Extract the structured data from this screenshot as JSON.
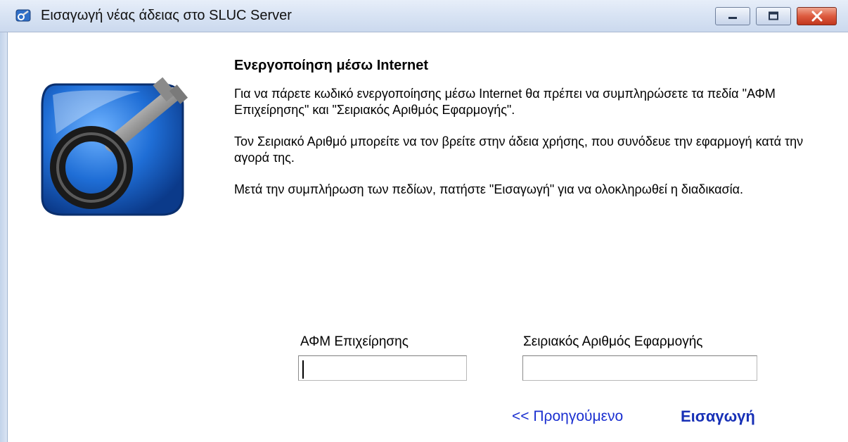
{
  "window": {
    "title": "Εισαγωγή νέας άδειας στο SLUC Server",
    "buttons": [
      "minimize-icon",
      "maximize-icon",
      "close-icon"
    ],
    "close_color": "#d84a2c"
  },
  "content": {
    "heading": "Ενεργοποίηση μέσω Internet",
    "paragraphs": [
      "Για να πάρετε κωδικό ενεργοποίησης μέσω Internet θα πρέπει να συμπληρώσετε τα πεδία \"ΑΦΜ Επιχείρησης\" και \"Σειριακός Αριθμός Εφαρμογής\".",
      "Τον Σειριακό Αριθμό μπορείτε να τον βρείτε στην άδεια χρήσης, που συνόδευε την εφαρμογή κατά την αγορά της.",
      "Μετά την συμπλήρωση των πεδίων, πατήστε \"Εισαγωγή\" για να ολοκληρωθεί η διαδικασία."
    ]
  },
  "form": {
    "afm": {
      "label": "ΑΦΜ Επιχείρησης",
      "value": ""
    },
    "serial": {
      "label": "Σειριακός Αριθμός Εφαρμογής",
      "value": ""
    }
  },
  "nav": {
    "back_label": "<< Προηγούμενο",
    "submit_label": "Εισαγωγή",
    "link_color": "#1a2fd0"
  },
  "icons": {
    "app": "key-app-icon",
    "logo": "key-logo-icon"
  }
}
